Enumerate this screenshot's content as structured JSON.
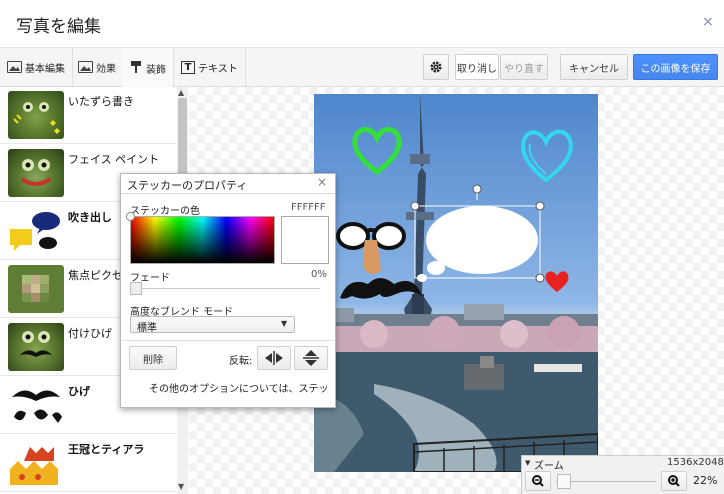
{
  "window": {
    "title": "写真を編集",
    "close_glyph": "×"
  },
  "toolbar": {
    "tabs": [
      {
        "label": "基本編集",
        "icon": "photo-basic-icon"
      },
      {
        "label": "効果",
        "icon": "effects-icon"
      },
      {
        "label": "装飾",
        "icon": "decorate-brush-icon"
      },
      {
        "label": "テキスト",
        "icon": "text-icon"
      }
    ],
    "active_tab": "装飾",
    "settings_icon": "gear-icon",
    "undo_label": "取り消し",
    "redo_label": "やり直す",
    "cancel_label": "キャンセル",
    "save_label": "この画像を保存"
  },
  "sidebar": {
    "items": [
      {
        "label": "いたずら書き",
        "icon": "frog-doodle-icon"
      },
      {
        "label": "フェイス ペイント",
        "icon": "frog-facepaint-icon"
      },
      {
        "label": "吹き出し",
        "icon": "speech-bubbles-icon"
      },
      {
        "label": "焦点ピクセ",
        "icon": "frog-pixelate-icon"
      },
      {
        "label": "付けひげ",
        "icon": "frog-mustache-icon"
      },
      {
        "label": "ひげ",
        "icon": "mustache-icon"
      },
      {
        "label": "王冠とティアラ",
        "icon": "crown-icon"
      }
    ]
  },
  "dialog": {
    "title": "ステッカーのプロパティ",
    "color_label": "ステッカーの色",
    "color_value": "FFFFFF",
    "fade_label": "フェード",
    "fade_value": "0%",
    "blend_label": "高度なブレンド モード",
    "blend_selected": "標準",
    "delete_label": "削除",
    "flip_label": "反転:",
    "more_options": "その他のオプションについては、ステッ"
  },
  "zoom": {
    "label": "ズーム",
    "dimensions": "1536x2048",
    "percent": "22%",
    "level": 0.22
  },
  "colors": {
    "accent_blue": "#4d90fe",
    "heart_green": "#33e03a",
    "heart_cyan": "#33d8f0",
    "heart_red": "#e8221e"
  }
}
